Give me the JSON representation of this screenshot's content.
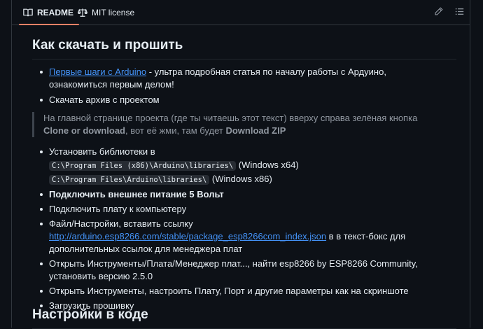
{
  "tabs": {
    "readme": "README",
    "license": "MIT license"
  },
  "toolbar": {
    "edit_icon": "pencil-icon",
    "toc_icon": "list-unordered-icon"
  },
  "section1": {
    "title": "Как скачать и прошить",
    "items": [
      {
        "link": "Первые шаги с Arduino",
        "text": " - ультра подробная статья по началу работы с Ардуино, ознакомиться первым делом!"
      },
      {
        "text": "Скачать архив с проектом"
      }
    ],
    "quote": {
      "part1": "На главной странице проекта (где ты читаешь этот текст) вверху справа зелёная кнопка ",
      "bold1": "Clone or download",
      "part2": ", вот её жми, там будет ",
      "bold2": "Download ZIP"
    },
    "steps": {
      "libs_label": "Установить библиотеки в",
      "path_x64": "C:\\Program Files (x86)\\Arduino\\libraries\\",
      "path_x64_note": " (Windows x64)",
      "path_x86": "C:\\Program Files\\Arduino\\libraries\\",
      "path_x86_note": " (Windows x86)",
      "power": "Подключить внешнее питание 5 Вольт",
      "connect": "Подключить плату к компьютеру",
      "settings_prefix": "Файл/Настройки, вставить ссылку ",
      "settings_link": "http://arduino.esp8266.com/stable/package_esp8266com_index.json",
      "settings_suffix": " в в текст-бокс для дополнительных ссылок для менеджера плат",
      "boards": "Открыть Инструменты/Плата/Менеджер плат..., найти esp8266 by ESP8266 Community, установить версию 2.5.0",
      "tools": "Открыть Инструменты, настроить Плату, Порт и другие параметры как на скриншоте",
      "upload": "Загрузить прошивку"
    }
  },
  "section2": {
    "title": "Настройки в коде"
  }
}
